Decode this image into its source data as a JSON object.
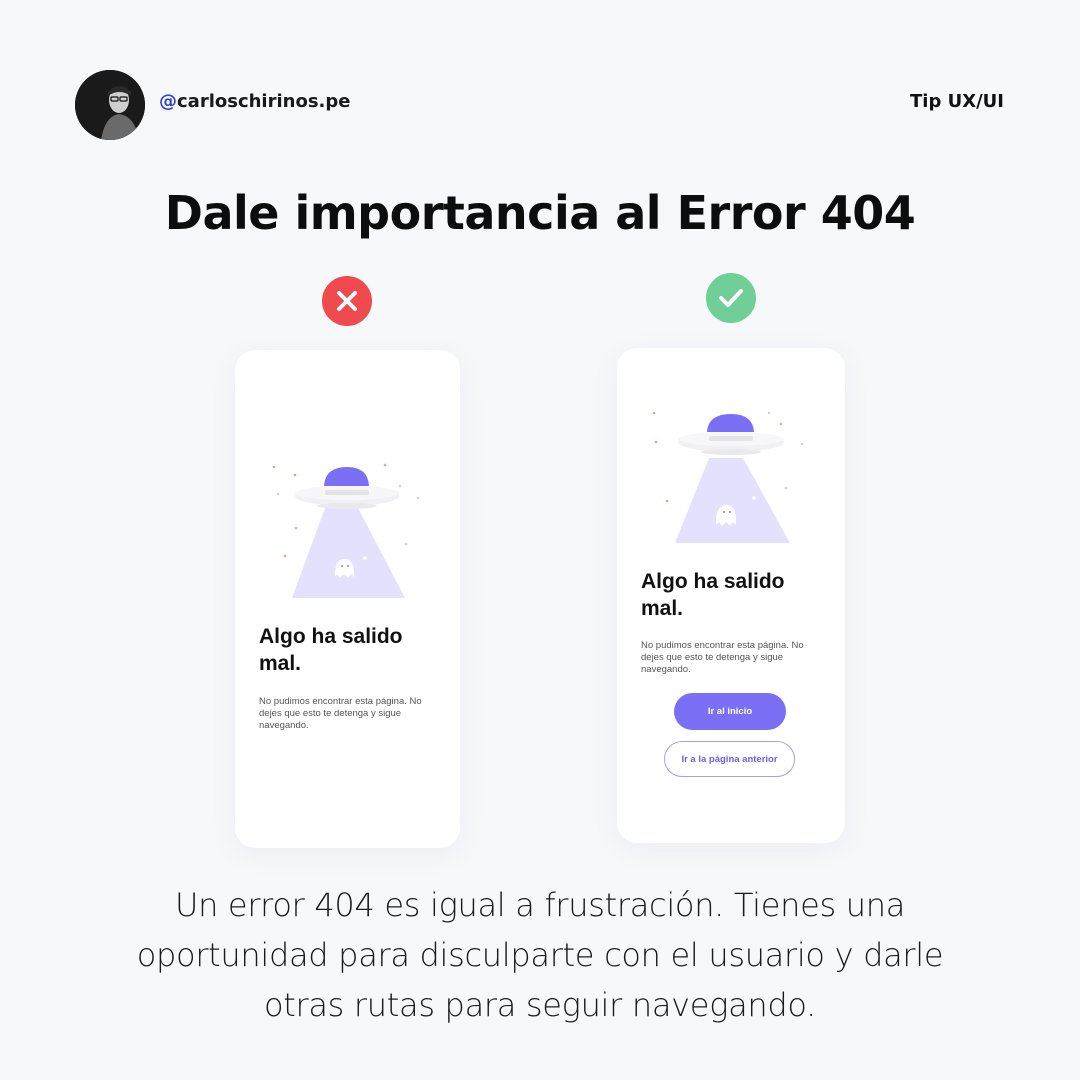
{
  "header": {
    "handle": "@carloschirinos.pe",
    "tag": "Tip UX/UI"
  },
  "headline": "Dale importancia al Error 404",
  "bad_example": {
    "badge_icon": "x-icon",
    "badge_color": "#ef4a4d",
    "title": "Algo ha salido mal.",
    "body": "No pudimos encontrar esta página. No dejes que esto te detenga y sigue navegando."
  },
  "good_example": {
    "badge_icon": "check-icon",
    "badge_color": "#6fcf97",
    "title": "Algo ha salido mal.",
    "body": "No pudimos encontrar esta página. No dejes que esto te detenga y sigue navegando.",
    "primary_button": "Ir al inicio",
    "secondary_button": "Ir a la página anterior",
    "accent_color": "#7b6ff5"
  },
  "footer": {
    "line1": "Un error 404 es igual a frustración. Tienes una",
    "line2": "oportunidad para disculparte con el usuario y darle",
    "line3": "otras rutas para seguir navegando."
  }
}
